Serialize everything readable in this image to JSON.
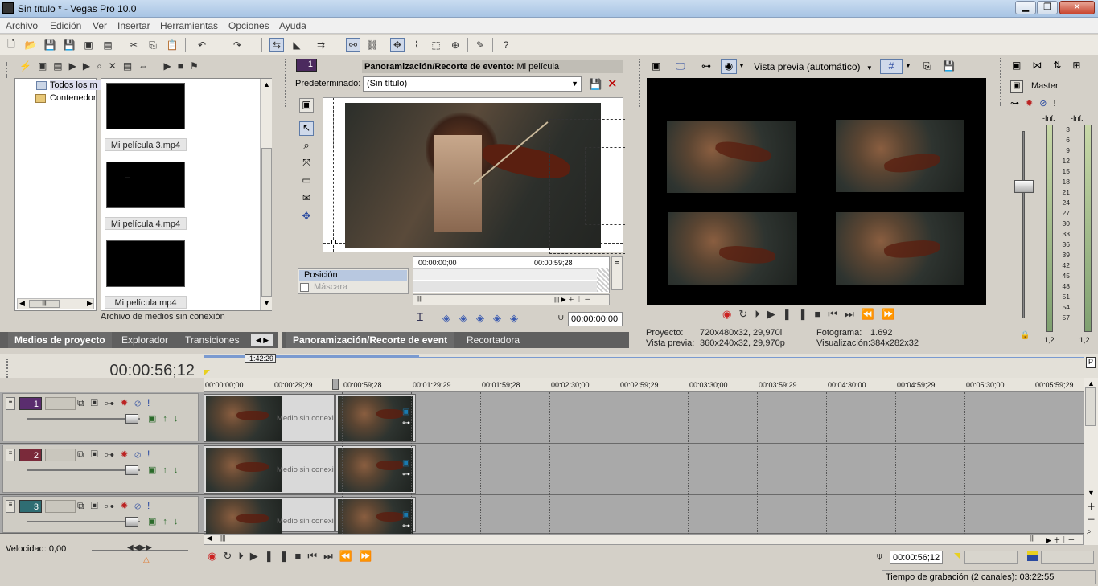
{
  "window": {
    "title": "Sin título * - Vegas Pro 10.0",
    "minimize": "▁",
    "maximize": "❐",
    "close": "✕"
  },
  "menu": [
    "Archivo",
    "Edición",
    "Ver",
    "Insertar",
    "Herramientas",
    "Opciones",
    "Ayuda"
  ],
  "media_panel": {
    "tree": [
      "Todos los m",
      "Contenedor"
    ],
    "items": [
      "Mi película 3.mp4",
      "Mi película 4.mp4",
      "Mi película.mp4"
    ],
    "footer": "Archivo de medios sin conexión",
    "tabs": [
      "Medios de proyecto",
      "Explorador",
      "Transiciones"
    ]
  },
  "pan_crop": {
    "track_num": "1",
    "header_label": "Panoramización/Recorte de evento:",
    "header_value": "Mi película",
    "preset_label": "Predeterminado:",
    "preset_value": "(Sin título)",
    "props": [
      "Posición",
      "Máscara"
    ],
    "time_start": "00:00:00;00",
    "time_end": "00:00:59;28",
    "current_time": "00:00:00;00",
    "tabs": [
      "Panoramización/Recorte de event",
      "Recortadora"
    ]
  },
  "preview": {
    "mode": "Vista previa (automático)",
    "project_label": "Proyecto:",
    "project_value": "720x480x32, 29,970i",
    "preview_label": "Vista previa:",
    "preview_value": "360x240x32, 29,970p",
    "frame_label": "Fotograma:",
    "frame_value": "1.692",
    "display_label": "Visualización:",
    "display_value": "384x282x32"
  },
  "master": {
    "label": "Master",
    "inf_left": "-Inf.",
    "inf_right": "-Inf.",
    "scale": [
      "3",
      "6",
      "9",
      "12",
      "15",
      "18",
      "21",
      "24",
      "27",
      "30",
      "33",
      "36",
      "39",
      "42",
      "45",
      "48",
      "51",
      "54",
      "57"
    ],
    "bottom_left": "1,2",
    "bottom_right": "1,2"
  },
  "timeline": {
    "current_time": "00:00:56;12",
    "loop_length": "-1:42:29",
    "ruler": [
      "00:00:00;00",
      "00:00:29;29",
      "00:00:59;28",
      "00:01:29;29",
      "00:01:59;28",
      "00:02:30;00",
      "00:02:59;29",
      "00:03:30;00",
      "00:03:59;29",
      "00:04:30;00",
      "00:04:59;29",
      "00:05:30;00",
      "00:05:59;29"
    ],
    "tracks": [
      {
        "num": "1",
        "color": "#5a2d6e"
      },
      {
        "num": "2",
        "color": "#7a2a3a"
      },
      {
        "num": "3",
        "color": "#2f6d73"
      }
    ],
    "offline_label": "Medio sin conexión",
    "speed_label": "Velocidad: 0,00",
    "cursor_time": "00:00:56;12",
    "status": "Tiempo de grabación (2 canales): 03:22:55"
  }
}
